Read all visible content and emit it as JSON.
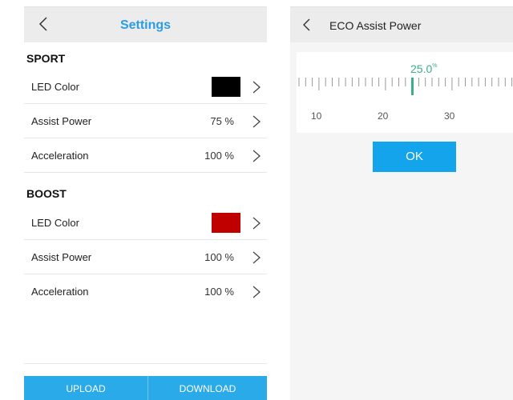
{
  "settings_screen": {
    "title": "Settings",
    "sections": [
      {
        "title": "SPORT",
        "rows": [
          {
            "label": "LED Color",
            "color": "#000000"
          },
          {
            "label": "Assist Power",
            "value": "75 %"
          },
          {
            "label": "Acceleration",
            "value": "100 %"
          }
        ]
      },
      {
        "title": "BOOST",
        "rows": [
          {
            "label": "LED Color",
            "color": "#c00000"
          },
          {
            "label": "Assist Power",
            "value": "100 %"
          },
          {
            "label": "Acceleration",
            "value": "100 %"
          }
        ]
      }
    ],
    "footer": {
      "upload_label": "UPLOAD",
      "download_label": "DOWNLOAD"
    }
  },
  "eco_screen": {
    "title": "ECO Assist Power",
    "ruler": {
      "value": "25.0",
      "unit": "%",
      "ticks": [
        "10",
        "20",
        "30"
      ]
    },
    "ok_label": "OK"
  },
  "colors": {
    "accent": "#2aaae8",
    "title_blue": "#2b9ce6",
    "ruler_green": "#3cae8b"
  }
}
